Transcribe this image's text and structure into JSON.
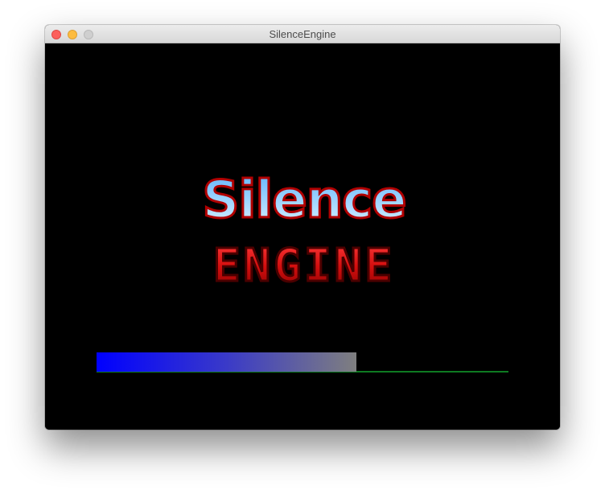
{
  "window": {
    "title": "SilenceEngine"
  },
  "logo": {
    "line1": "Silence",
    "line2": "ENGINE"
  },
  "loading": {
    "progress": 0.63,
    "fill_color_start": "#0000ff",
    "fill_color_end": "#7f7f7f",
    "track_color": "#0e7a22"
  },
  "colors": {
    "background": "#000000",
    "logo_top": "#8fd3ff",
    "logo_bottom": "#ff2a2a"
  }
}
